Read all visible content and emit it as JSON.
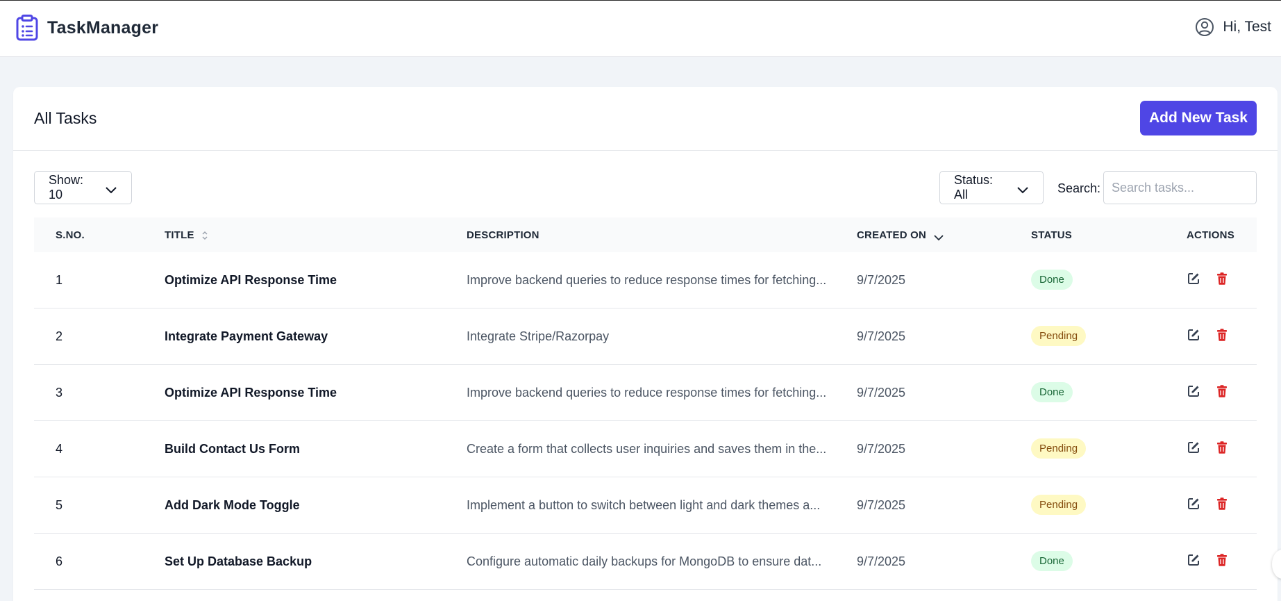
{
  "app": {
    "name": "TaskManager",
    "brand_icon": "clipboard-list-icon",
    "accent": "#4f46e5"
  },
  "user": {
    "greeting": "Hi, Test",
    "icon": "user-circle-icon"
  },
  "card": {
    "title": "All Tasks",
    "add_button": "Add New Task"
  },
  "controls": {
    "show_label": "Show: 10",
    "status_label": "Status: All",
    "search_label": "Search:",
    "search_placeholder": "Search tasks...",
    "search_value": ""
  },
  "table": {
    "headers": {
      "sno": "S.NO.",
      "title": "TITLE",
      "description": "DESCRIPTION",
      "created_on": "CREATED ON",
      "status": "STATUS",
      "actions": "ACTIONS"
    },
    "rows": [
      {
        "sno": "1",
        "title": "Optimize API Response Time",
        "description": "Improve backend queries to reduce response times for fetching...",
        "created_on": "9/7/2025",
        "status": "Done"
      },
      {
        "sno": "2",
        "title": "Integrate Payment Gateway",
        "description": "Integrate Stripe/Razorpay",
        "created_on": "9/7/2025",
        "status": "Pending"
      },
      {
        "sno": "3",
        "title": "Optimize API Response Time",
        "description": "Improve backend queries to reduce response times for fetching...",
        "created_on": "9/7/2025",
        "status": "Done"
      },
      {
        "sno": "4",
        "title": "Build Contact Us Form",
        "description": "Create a form that collects user inquiries and saves them in the...",
        "created_on": "9/7/2025",
        "status": "Pending"
      },
      {
        "sno": "5",
        "title": "Add Dark Mode Toggle",
        "description": "Implement a button to switch between light and dark themes a...",
        "created_on": "9/7/2025",
        "status": "Pending"
      },
      {
        "sno": "6",
        "title": "Set Up Database Backup",
        "description": "Configure automatic daily backups for MongoDB to ensure dat...",
        "created_on": "9/7/2025",
        "status": "Done"
      }
    ]
  },
  "colors": {
    "done_bg": "#dcfce7",
    "done_text": "#166534",
    "pending_bg": "#fef9c3",
    "pending_text": "#854d0e",
    "delete": "#dc2626"
  }
}
